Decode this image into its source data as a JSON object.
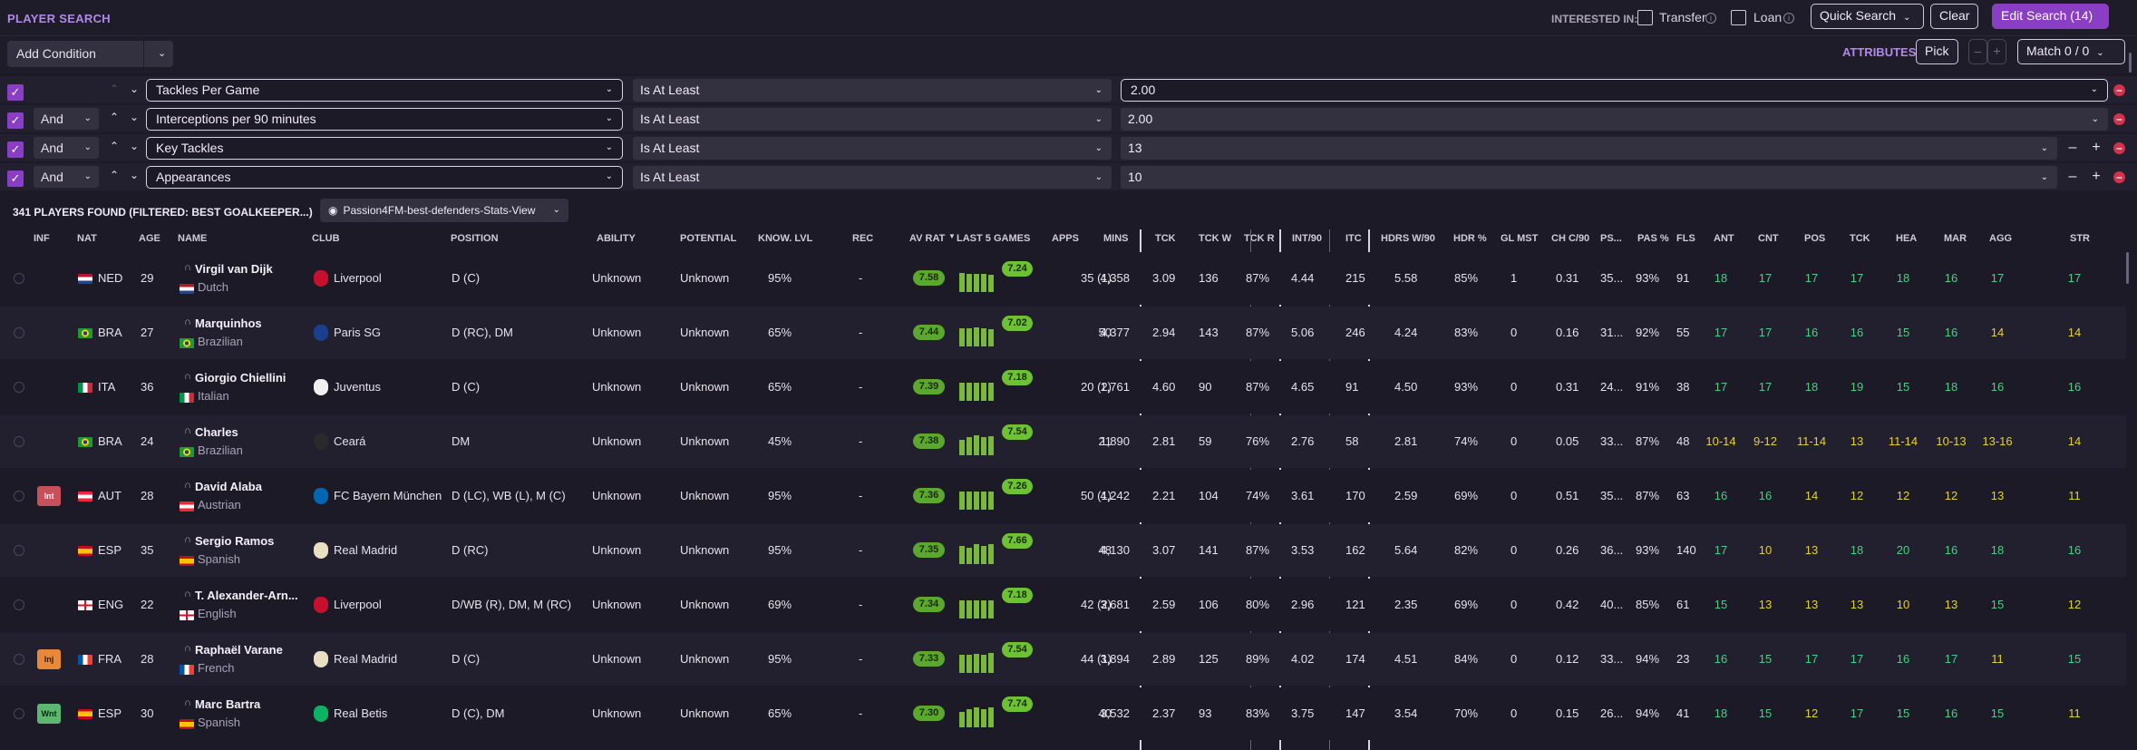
{
  "topbar": {
    "title": "PLAYER SEARCH",
    "interested_in": "INTERESTED IN:",
    "transfer": "Transfer",
    "loan": "Loan",
    "quick_search": "Quick Search",
    "clear": "Clear",
    "edit_search": "Edit Search (14)"
  },
  "filters": {
    "add_condition": "Add Condition",
    "attributes_label": "ATTRIBUTES",
    "pick": "Pick",
    "minus": "–",
    "plus": "+",
    "match": "Match 0 / 0",
    "conditions": [
      {
        "join": "",
        "field": "Tackles Per Game",
        "operator": "Is At Least",
        "value": "2.00"
      },
      {
        "join": "And",
        "field": "Interceptions per 90 minutes",
        "operator": "Is At Least",
        "value": "2.00"
      },
      {
        "join": "And",
        "field": "Key Tackles",
        "operator": "Is At Least",
        "value": "13"
      },
      {
        "join": "And",
        "field": "Appearances",
        "operator": "Is At Least",
        "value": "10"
      }
    ]
  },
  "results": {
    "count": "341 PLAYERS FOUND (FILTERED: BEST GOALKEEPER...)",
    "view": "Passion4FM-best-defenders-Stats-View"
  },
  "columns": [
    "INF",
    "NAT",
    "AGE",
    "NAME",
    "CLUB",
    "POSITION",
    "ABILITY",
    "POTENTIAL",
    "KNOW. LVL",
    "REC",
    "AV RAT",
    "LAST 5 GAMES",
    "APPS",
    "MINS",
    "TCK",
    "TCK W",
    "TCK R",
    "INT/90",
    "ITC",
    "HDRS W/90",
    "HDR %",
    "GL MST",
    "CH C/90",
    "PS...",
    "PAS %",
    "FLS",
    "ANT",
    "CNT",
    "POS",
    "TCK",
    "HEA",
    "MAR",
    "AGG",
    "STR"
  ],
  "colors": {
    "accent": "#8a3ec4",
    "rating_green": "#5aa82c",
    "attr_green": "#49d17c",
    "attr_yellow": "#e6cf3a"
  },
  "players": [
    {
      "inf": "",
      "nat": "NED",
      "age": "29",
      "name": "Virgil van Dijk",
      "nationality": "Dutch",
      "club": "Liverpool",
      "position": "D (C)",
      "ability": "Unknown",
      "potential": "Unknown",
      "know": "95%",
      "rec": "-",
      "av_rat": "7.58",
      "last": "7.24",
      "bars": [
        0.75,
        0.7,
        0.7,
        0.72,
        0.68
      ],
      "apps": "35 (1)",
      "mins": "4,358",
      "tck": "3.09",
      "tckw": "136",
      "tckr": "87%",
      "int90": "4.44",
      "itc": "215",
      "hdrs": "5.58",
      "hdrp": "85%",
      "glmst": "1",
      "chc": "0.31",
      "ps": "35...",
      "pas": "93%",
      "fls": "91",
      "attrs": [
        "18",
        "17",
        "17",
        "17",
        "18",
        "16",
        "17",
        "17"
      ],
      "attr_colors": [
        "g",
        "g",
        "g",
        "g",
        "g",
        "g",
        "g",
        "g"
      ]
    },
    {
      "inf": "",
      "nat": "BRA",
      "age": "27",
      "name": "Marquinhos",
      "nationality": "Brazilian",
      "club": "Paris SG",
      "position": "D (RC), DM",
      "ability": "Unknown",
      "potential": "Unknown",
      "know": "65%",
      "rec": "-",
      "av_rat": "7.44",
      "last": "7.02",
      "bars": [
        0.72,
        0.7,
        0.74,
        0.7,
        0.68
      ],
      "apps": "50",
      "mins": "4,377",
      "tck": "2.94",
      "tckw": "143",
      "tckr": "87%",
      "int90": "5.06",
      "itc": "246",
      "hdrs": "4.24",
      "hdrp": "83%",
      "glmst": "0",
      "chc": "0.16",
      "ps": "31...",
      "pas": "92%",
      "fls": "55",
      "attrs": [
        "17",
        "17",
        "16",
        "16",
        "15",
        "16",
        "14",
        "14"
      ],
      "attr_colors": [
        "g",
        "g",
        "g",
        "g",
        "g",
        "g",
        "y",
        "y"
      ]
    },
    {
      "inf": "",
      "nat": "ITA",
      "age": "36",
      "name": "Giorgio Chiellini",
      "nationality": "Italian",
      "club": "Juventus",
      "position": "D (C)",
      "ability": "Unknown",
      "potential": "Unknown",
      "know": "65%",
      "rec": "-",
      "av_rat": "7.39",
      "last": "7.18",
      "bars": [
        0.72,
        0.7,
        0.72,
        0.7,
        0.7
      ],
      "apps": "20 (2)",
      "mins": "1,761",
      "tck": "4.60",
      "tckw": "90",
      "tckr": "87%",
      "int90": "4.65",
      "itc": "91",
      "hdrs": "4.50",
      "hdrp": "93%",
      "glmst": "0",
      "chc": "0.31",
      "ps": "24...",
      "pas": "91%",
      "fls": "38",
      "attrs": [
        "17",
        "17",
        "18",
        "19",
        "15",
        "18",
        "16",
        "16"
      ],
      "attr_colors": [
        "g",
        "g",
        "g",
        "g",
        "g",
        "g",
        "g",
        "g"
      ]
    },
    {
      "inf": "",
      "nat": "BRA",
      "age": "24",
      "name": "Charles",
      "nationality": "Brazilian",
      "club": "Ceará",
      "position": "DM",
      "ability": "Unknown",
      "potential": "Unknown",
      "know": "45%",
      "rec": "-",
      "av_rat": "7.38",
      "last": "7.54",
      "bars": [
        0.6,
        0.7,
        0.8,
        0.72,
        0.76
      ],
      "apps": "21",
      "mins": "1,890",
      "tck": "2.81",
      "tckw": "59",
      "tckr": "76%",
      "int90": "2.76",
      "itc": "58",
      "hdrs": "2.81",
      "hdrp": "74%",
      "glmst": "0",
      "chc": "0.05",
      "ps": "33...",
      "pas": "87%",
      "fls": "48",
      "attrs": [
        "10-14",
        "9-12",
        "11-14",
        "13",
        "11-14",
        "10-13",
        "13-16",
        "14"
      ],
      "attr_colors": [
        "y",
        "y",
        "y",
        "y",
        "y",
        "y",
        "y",
        "y"
      ]
    },
    {
      "inf": "Int",
      "nat": "AUT",
      "age": "28",
      "name": "David Alaba",
      "nationality": "Austrian",
      "club": "FC Bayern München",
      "position": "D (LC), WB (L), M (C)",
      "ability": "Unknown",
      "potential": "Unknown",
      "know": "95%",
      "rec": "-",
      "av_rat": "7.36",
      "last": "7.26",
      "bars": [
        0.7,
        0.72,
        0.7,
        0.7,
        0.7
      ],
      "apps": "50 (1)",
      "mins": "4,242",
      "tck": "2.21",
      "tckw": "104",
      "tckr": "74%",
      "int90": "3.61",
      "itc": "170",
      "hdrs": "2.59",
      "hdrp": "69%",
      "glmst": "0",
      "chc": "0.51",
      "ps": "35...",
      "pas": "87%",
      "fls": "63",
      "attrs": [
        "16",
        "16",
        "14",
        "12",
        "12",
        "12",
        "13",
        "11"
      ],
      "attr_colors": [
        "g",
        "g",
        "y",
        "y",
        "y",
        "y",
        "y",
        "y"
      ]
    },
    {
      "inf": "",
      "nat": "ESP",
      "age": "35",
      "name": "Sergio Ramos",
      "nationality": "Spanish",
      "club": "Real Madrid",
      "position": "D (RC)",
      "ability": "Unknown",
      "potential": "Unknown",
      "know": "95%",
      "rec": "-",
      "av_rat": "7.35",
      "last": "7.66",
      "bars": [
        0.7,
        0.65,
        0.78,
        0.72,
        0.8
      ],
      "apps": "48",
      "mins": "4,130",
      "tck": "3.07",
      "tckw": "141",
      "tckr": "87%",
      "int90": "3.53",
      "itc": "162",
      "hdrs": "5.64",
      "hdrp": "82%",
      "glmst": "0",
      "chc": "0.26",
      "ps": "36...",
      "pas": "93%",
      "fls": "140",
      "attrs": [
        "17",
        "10",
        "13",
        "18",
        "20",
        "16",
        "18",
        "16"
      ],
      "attr_colors": [
        "g",
        "y",
        "y",
        "g",
        "g",
        "g",
        "g",
        "g"
      ]
    },
    {
      "inf": "",
      "nat": "ENG",
      "age": "22",
      "name": "T. Alexander-Arn...",
      "nationality": "English",
      "club": "Liverpool",
      "position": "D/WB (R), DM, M (RC)",
      "ability": "Unknown",
      "potential": "Unknown",
      "know": "69%",
      "rec": "-",
      "av_rat": "7.34",
      "last": "7.18",
      "bars": [
        0.72,
        0.7,
        0.7,
        0.72,
        0.7
      ],
      "apps": "42 (2)",
      "mins": "3,681",
      "tck": "2.59",
      "tckw": "106",
      "tckr": "80%",
      "int90": "2.96",
      "itc": "121",
      "hdrs": "2.35",
      "hdrp": "69%",
      "glmst": "0",
      "chc": "0.42",
      "ps": "40...",
      "pas": "85%",
      "fls": "61",
      "attrs": [
        "15",
        "13",
        "13",
        "13",
        "10",
        "13",
        "15",
        "12"
      ],
      "attr_colors": [
        "g",
        "y",
        "y",
        "y",
        "y",
        "y",
        "g",
        "y"
      ]
    },
    {
      "inf": "Inj",
      "nat": "FRA",
      "age": "28",
      "name": "Raphaël Varane",
      "nationality": "French",
      "club": "Real Madrid",
      "position": "D (C)",
      "ability": "Unknown",
      "potential": "Unknown",
      "know": "95%",
      "rec": "-",
      "av_rat": "7.33",
      "last": "7.54",
      "bars": [
        0.7,
        0.72,
        0.74,
        0.7,
        0.78
      ],
      "apps": "44 (1)",
      "mins": "3,894",
      "tck": "2.89",
      "tckw": "125",
      "tckr": "89%",
      "int90": "4.02",
      "itc": "174",
      "hdrs": "4.51",
      "hdrp": "84%",
      "glmst": "0",
      "chc": "0.12",
      "ps": "33...",
      "pas": "94%",
      "fls": "23",
      "attrs": [
        "16",
        "15",
        "17",
        "17",
        "16",
        "17",
        "11",
        "15"
      ],
      "attr_colors": [
        "g",
        "g",
        "g",
        "g",
        "g",
        "g",
        "y",
        "g"
      ]
    },
    {
      "inf": "Wnt",
      "nat": "ESP",
      "age": "30",
      "name": "Marc Bartra",
      "nationality": "Spanish",
      "club": "Real Betis",
      "position": "D (C), DM",
      "ability": "Unknown",
      "potential": "Unknown",
      "know": "65%",
      "rec": "-",
      "av_rat": "7.30",
      "last": "7.74",
      "bars": [
        0.6,
        0.72,
        0.78,
        0.7,
        0.8
      ],
      "apps": "40",
      "mins": "3,532",
      "tck": "2.37",
      "tckw": "93",
      "tckr": "83%",
      "int90": "3.75",
      "itc": "147",
      "hdrs": "3.54",
      "hdrp": "70%",
      "glmst": "0",
      "chc": "0.15",
      "ps": "26...",
      "pas": "94%",
      "fls": "41",
      "attrs": [
        "18",
        "15",
        "12",
        "17",
        "15",
        "16",
        "15",
        "11"
      ],
      "attr_colors": [
        "g",
        "g",
        "y",
        "g",
        "g",
        "g",
        "g",
        "y"
      ]
    }
  ]
}
